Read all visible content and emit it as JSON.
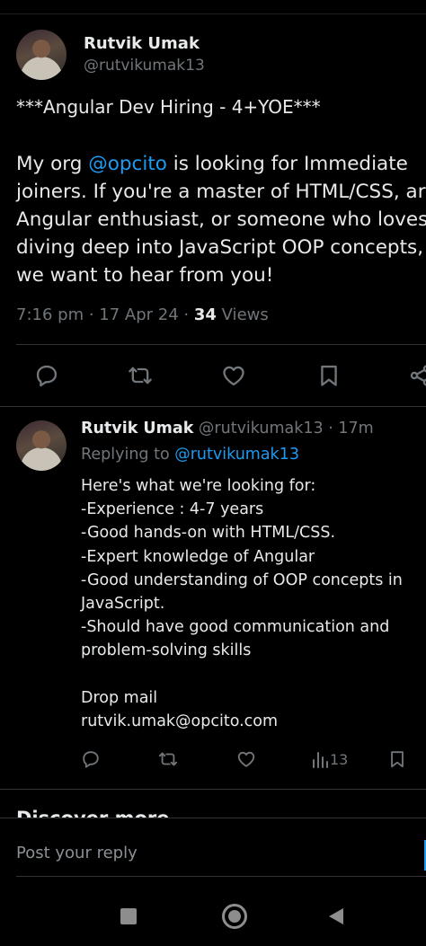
{
  "tweet": {
    "author_name": "Rutvik Umak",
    "author_handle": "@rutvikumak13",
    "title_line": "***Angular Dev Hiring - 4+YOE***",
    "body_prefix": "My org ",
    "mention": "@opcito",
    "body_line1_rest": " is looking for Immediate",
    "body_line2": "joiners. If you're a master of HTML/CSS, ar",
    "body_line3": "Angular enthusiast, or someone who loves",
    "body_line4": "diving deep into JavaScript OOP concepts,",
    "body_line5": "we want to hear from you!",
    "time": "7:16 pm",
    "sep": " · ",
    "date": "17 Apr 24",
    "views_count": "34",
    "views_label": " Views"
  },
  "reply": {
    "author_name": "Rutvik Umak",
    "author_handle": "@rutvikumak13",
    "time_ago": " · 17m",
    "replying_label": "Replying to ",
    "replying_handle": "@rutvikumak13",
    "lines": [
      "Here's what we're looking for:",
      "-Experience : 4-7 years",
      "-Good hands-on with HTML/CSS.",
      "-Expert knowledge of Angular",
      "-Good understanding of OOP concepts in",
      "JavaScript.",
      "-Should have good communication and",
      "problem-solving skills",
      "",
      "Drop mail",
      "rutvik.umak@opcito.com"
    ],
    "views": "13"
  },
  "discover_label": "Discover more",
  "compose": {
    "placeholder": "Post your reply"
  },
  "icons": {
    "reply": "reply-icon",
    "repost": "repost-icon",
    "like": "like-icon",
    "bookmark": "bookmark-icon",
    "share": "share-icon",
    "views": "views-icon",
    "nav_recents": "square-icon",
    "nav_home": "circle-icon",
    "nav_back": "back-triangle-icon"
  }
}
